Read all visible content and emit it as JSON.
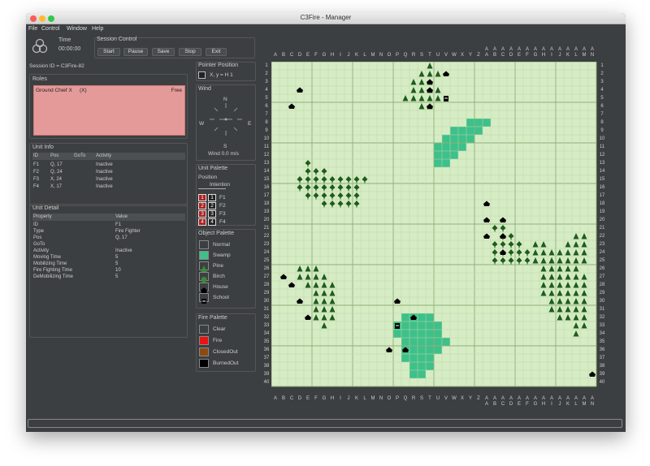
{
  "window": {
    "title": "C3Fire - Manager"
  },
  "menu": [
    "File",
    "Control",
    "Window",
    "Help"
  ],
  "time": {
    "label": "Time",
    "value": "00:00:00"
  },
  "session_control": {
    "title": "Session Control",
    "buttons": [
      "Start",
      "Pause",
      "Save",
      "Stop",
      "Exit"
    ]
  },
  "session_id": "Session ID = C3Fire-82",
  "roles": {
    "title": "Roles",
    "name": "Ground Chief X",
    "marker": "(X)",
    "status": "Free"
  },
  "unit_info": {
    "title": "Unit Info",
    "headers": [
      "ID",
      "Pos",
      "GoTo",
      "Activity"
    ],
    "rows": [
      [
        "F1",
        "Q, 17",
        "",
        "Inactive"
      ],
      [
        "F2",
        "Q, 24",
        "",
        "Inactive"
      ],
      [
        "F3",
        "X, 24",
        "",
        "Inactive"
      ],
      [
        "F4",
        "X, 17",
        "",
        "Inactive"
      ]
    ]
  },
  "unit_detail": {
    "title": "Unit Detail",
    "headers": [
      "Property",
      "Value"
    ],
    "rows": [
      [
        "ID",
        "F1"
      ],
      [
        "Type",
        "Fire Fighter"
      ],
      [
        "Pos",
        "Q, 17"
      ],
      [
        "GoTo",
        ""
      ],
      [
        "Activity",
        "Inactive"
      ],
      [
        "Moving Time",
        "5"
      ],
      [
        "Mobilizing Time",
        "5"
      ],
      [
        "Fire Fighting Time",
        "10"
      ],
      [
        "DeMobilizing Time",
        "5"
      ]
    ]
  },
  "pointer_position": {
    "title": "Pointer Position",
    "text": "X, y = H 1"
  },
  "wind": {
    "title": "Wind",
    "n": "N",
    "s": "S",
    "e": "E",
    "w": "W",
    "speed": "Wind 0.0 m/s"
  },
  "unit_palette": {
    "title": "Unit Palette",
    "position": "Position",
    "intention": "Intention",
    "units": [
      {
        "label": "F1",
        "n": "1"
      },
      {
        "label": "F2",
        "n": "2"
      },
      {
        "label": "F3",
        "n": "3"
      },
      {
        "label": "F4",
        "n": "4"
      }
    ]
  },
  "object_palette": {
    "title": "Object Palette",
    "items": [
      {
        "label": "Normal",
        "color": "#3c3f41",
        "icon": "normal"
      },
      {
        "label": "Swamp",
        "color": "#3ec08a",
        "icon": "swamp"
      },
      {
        "label": "Pine",
        "color": "#3c3f41",
        "icon": "pine"
      },
      {
        "label": "Birch",
        "color": "#3c3f41",
        "icon": "birch"
      },
      {
        "label": "House",
        "color": "#3c3f41",
        "icon": "house"
      },
      {
        "label": "School",
        "color": "#3c3f41",
        "icon": "school"
      }
    ]
  },
  "fire_palette": {
    "title": "Fire Palette",
    "items": [
      {
        "label": "Clear",
        "color": "#3c3f41"
      },
      {
        "label": "Fire",
        "color": "#ee1111"
      },
      {
        "label": "ClosedOut",
        "color": "#8a4a12"
      },
      {
        "label": "BurnedOut",
        "color": "#000000"
      }
    ]
  },
  "map": {
    "columns": [
      "A",
      "B",
      "C",
      "D",
      "E",
      "F",
      "G",
      "H",
      "I",
      "J",
      "K",
      "L",
      "M",
      "N",
      "O",
      "P",
      "Q",
      "R",
      "S",
      "T",
      "U",
      "V",
      "W",
      "X",
      "Y",
      "Z",
      "AA",
      "AB",
      "AC",
      "AD",
      "AE",
      "AF",
      "AG",
      "AH",
      "AI",
      "AJ",
      "AK",
      "AL",
      "AM",
      "AN"
    ],
    "rows": 40,
    "colors": {
      "ground": "#d6ecc4",
      "minor_grid": "#bcd8a8",
      "major_grid": "#8fb07a",
      "swamp": "#3ec08a",
      "tree": "#1d5c1d"
    },
    "swamp_runs": [
      [
        8,
        25,
        27
      ],
      [
        9,
        23,
        26
      ],
      [
        10,
        22,
        25
      ],
      [
        11,
        21,
        24
      ],
      [
        12,
        21,
        23
      ],
      [
        13,
        21,
        22
      ],
      [
        32,
        17,
        20
      ],
      [
        33,
        16,
        21
      ],
      [
        34,
        16,
        21
      ],
      [
        35,
        17,
        22
      ],
      [
        36,
        17,
        21
      ],
      [
        37,
        17,
        20
      ],
      [
        38,
        18,
        20
      ],
      [
        39,
        18,
        19
      ]
    ],
    "pine_runs": [
      [
        1,
        20,
        20
      ],
      [
        2,
        19,
        21
      ],
      [
        3,
        18,
        20
      ],
      [
        4,
        18,
        21
      ],
      [
        5,
        17,
        21
      ],
      [
        6,
        19,
        20
      ],
      [
        26,
        4,
        6
      ],
      [
        27,
        4,
        7
      ],
      [
        28,
        5,
        8
      ],
      [
        29,
        6,
        8
      ],
      [
        30,
        6,
        8
      ],
      [
        31,
        6,
        8
      ],
      [
        32,
        6,
        8
      ],
      [
        33,
        7,
        7
      ],
      [
        23,
        33,
        34
      ],
      [
        24,
        33,
        35
      ],
      [
        25,
        33,
        36
      ],
      [
        26,
        34,
        38
      ],
      [
        27,
        34,
        39
      ],
      [
        28,
        34,
        39
      ],
      [
        29,
        34,
        39
      ],
      [
        30,
        35,
        39
      ],
      [
        31,
        35,
        39
      ],
      [
        32,
        36,
        39
      ],
      [
        33,
        38,
        39
      ],
      [
        34,
        38,
        38
      ],
      [
        22,
        38,
        39
      ],
      [
        23,
        37,
        39
      ],
      [
        24,
        36,
        39
      ],
      [
        25,
        35,
        39
      ]
    ],
    "birch_runs": [
      [
        13,
        5,
        5
      ],
      [
        14,
        5,
        7
      ],
      [
        15,
        4,
        12
      ],
      [
        16,
        4,
        11
      ],
      [
        17,
        5,
        11
      ],
      [
        18,
        7,
        11
      ],
      [
        21,
        28,
        29
      ],
      [
        22,
        29,
        30
      ],
      [
        23,
        28,
        31
      ],
      [
        24,
        28,
        32
      ],
      [
        25,
        28,
        32
      ]
    ],
    "houses": [
      [
        0,
        1
      ],
      [
        6,
        3
      ],
      [
        4,
        4
      ],
      [
        27,
        2
      ],
      [
        28,
        3
      ],
      [
        30,
        4
      ],
      [
        32,
        5
      ],
      [
        36,
        15
      ],
      [
        30,
        16
      ],
      [
        36,
        17
      ],
      [
        32,
        18
      ],
      [
        4,
        20
      ],
      [
        6,
        20
      ],
      [
        3,
        20
      ],
      [
        2,
        22
      ],
      [
        18,
        27
      ],
      [
        20,
        27
      ],
      [
        22,
        27
      ],
      [
        20,
        29
      ],
      [
        22,
        29
      ],
      [
        24,
        29
      ],
      [
        39,
        40
      ]
    ],
    "schools": [
      [
        33,
        16
      ],
      [
        5,
        22
      ]
    ]
  }
}
